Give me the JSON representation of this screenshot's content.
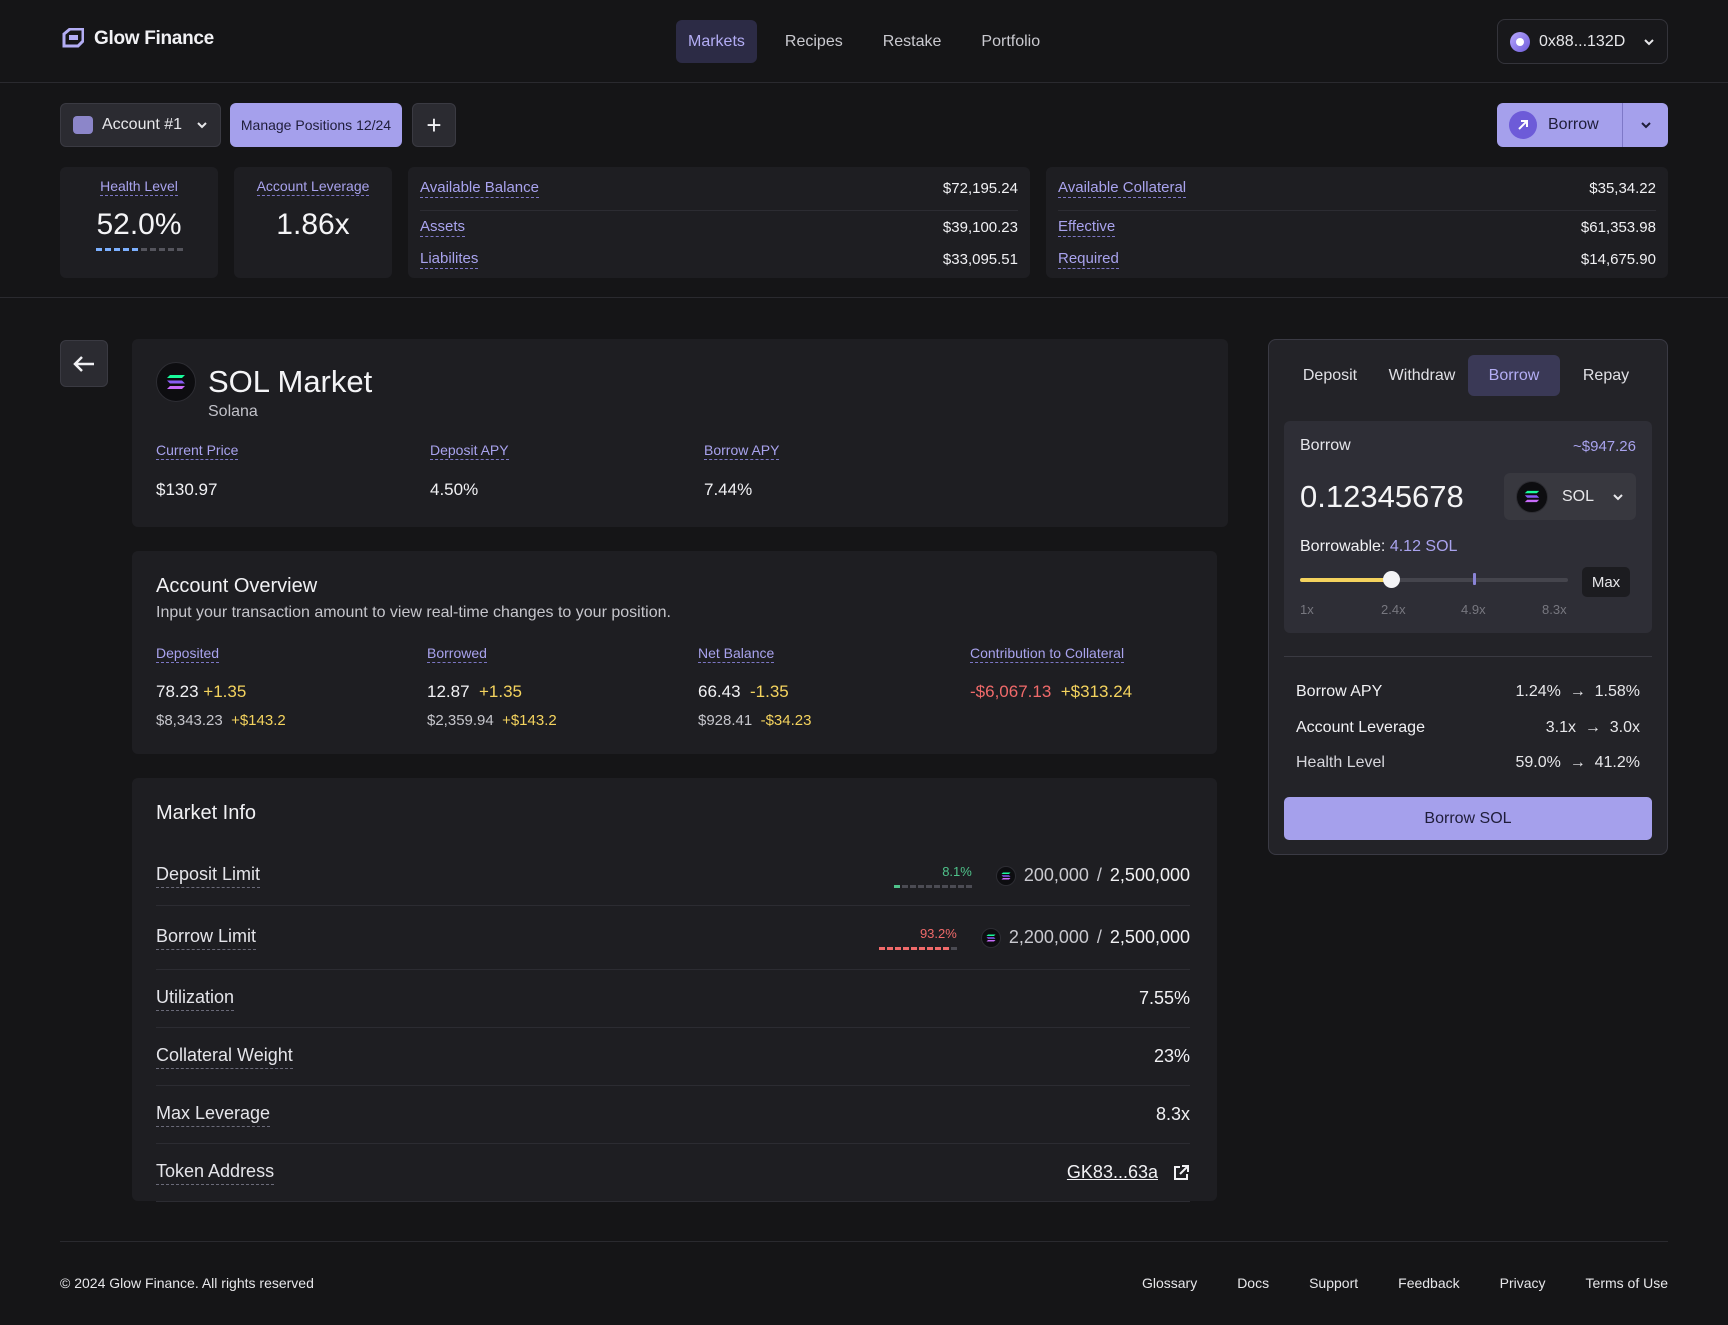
{
  "header": {
    "brand": "Glow Finance",
    "nav": [
      "Markets",
      "Recipes",
      "Restake",
      "Portfolio"
    ],
    "active_nav": "Markets",
    "wallet": "0x88...132D"
  },
  "toolbar": {
    "account": "Account #1",
    "manage_label": "Manage Positions",
    "manage_count": "12/24",
    "add": "+",
    "borrow": "Borrow"
  },
  "summary": {
    "health_label": "Health Level",
    "health_value": "52.0%",
    "health_fill": 0.52,
    "leverage_label": "Account Leverage",
    "leverage_value": "1.86x",
    "balance": {
      "available_label": "Available Balance",
      "available": "$72,195.24",
      "assets_label": "Assets",
      "assets": "$39,100.23",
      "liabilities_label": "Liabilites",
      "liabilities": "$33,095.51"
    },
    "collateral": {
      "available_label": "Available Collateral",
      "available": "$35,34.22",
      "effective_label": "Effective",
      "effective": "$61,353.98",
      "required_label": "Required",
      "required": "$14,675.90"
    }
  },
  "market": {
    "title": "SOL Market",
    "subtitle": "Solana",
    "current_price_label": "Current Price",
    "current_price": "$130.97",
    "deposit_apy_label": "Deposit APY",
    "deposit_apy": "4.50%",
    "borrow_apy_label": "Borrow APY",
    "borrow_apy": "7.44%"
  },
  "overview": {
    "title": "Account Overview",
    "desc": "Input your transaction amount to view real-time changes to your position.",
    "cols": [
      {
        "label": "Deposited",
        "big": "78.23",
        "big_delta": "+1.35",
        "small": "$8,343.23",
        "small_delta": "+$143.2"
      },
      {
        "label": "Borrowed",
        "big": "12.87",
        "big_delta": "+1.35",
        "small": "$2,359.94",
        "small_delta": "+$143.2"
      },
      {
        "label": "Net Balance",
        "big": "66.43",
        "big_delta": "-1.35",
        "small": "$928.41",
        "small_delta": "-$34.23"
      },
      {
        "label": "Contribution to Collateral",
        "big": "-$6,067.13",
        "big_delta": "+$313.24"
      }
    ]
  },
  "market_info": {
    "title": "Market Info",
    "deposit_limit_label": "Deposit Limit",
    "deposit_pct": "8.1%",
    "deposit_fill": 0.081,
    "deposit_used": "200,000",
    "deposit_total": "2,500,000",
    "borrow_limit_label": "Borrow Limit",
    "borrow_pct": "93.2%",
    "borrow_fill": 0.932,
    "borrow_used": "2,200,000",
    "borrow_total": "2,500,000",
    "utilization_label": "Utilization",
    "utilization": "7.55%",
    "collateral_weight_label": "Collateral Weight",
    "collateral_weight": "23%",
    "max_leverage_label": "Max Leverage",
    "max_leverage": "8.3x",
    "token_address_label": "Token Address",
    "token_address": "GK83...63a",
    "slash": "/"
  },
  "panel": {
    "tabs": [
      "Deposit",
      "Withdraw",
      "Borrow",
      "Repay"
    ],
    "active_tab": "Borrow",
    "borrow_label": "Borrow",
    "usd_value": "~$947.26",
    "amount": "0.12345678",
    "token": "SOL",
    "borrowable_label": "Borrowable:",
    "borrowable": "4.12 SOL",
    "slider_ticks": [
      "1x",
      "2.4x",
      "4.9x",
      "8.3x"
    ],
    "slider_value": "2.4x",
    "max": "Max",
    "changes": [
      {
        "label": "Borrow APY",
        "from": "1.24%",
        "to": "1.58%"
      },
      {
        "label": "Account Leverage",
        "from": "3.1x",
        "to": "3.0x"
      },
      {
        "label": "Health Level",
        "from": "59.0%",
        "to": "41.2%"
      }
    ],
    "arrow": "→",
    "cta": "Borrow SOL"
  },
  "footer": {
    "copyright": "© 2024 Glow Finance. All rights reserved",
    "links": [
      "Glossary",
      "Docs",
      "Support",
      "Feedback",
      "Privacy",
      "Terms of Use"
    ]
  },
  "colors": {
    "accent": "#a5a0ec",
    "positive": "#f4d35e",
    "negative": "#f06a6a",
    "green": "#4fc28a",
    "background": "#151517"
  }
}
